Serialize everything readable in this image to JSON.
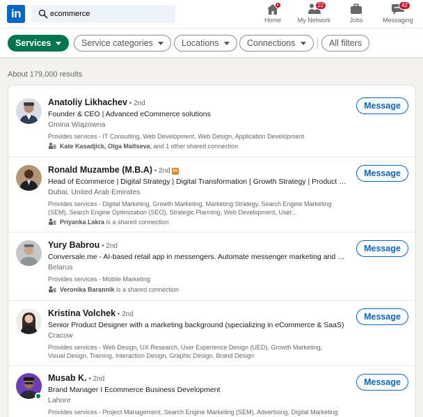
{
  "nav": {
    "logo": "in",
    "search_value": "ecommerce",
    "items": [
      {
        "label": "Home",
        "icon": "home-icon",
        "badge": ""
      },
      {
        "label": "My Network",
        "icon": "network-icon",
        "badge": "22"
      },
      {
        "label": "Jobs",
        "icon": "briefcase-icon",
        "badge": ""
      },
      {
        "label": "Messaging",
        "icon": "messaging-icon",
        "badge": "42"
      }
    ]
  },
  "filters": {
    "services": "Services",
    "service_categories": "Service categories",
    "locations": "Locations",
    "connections": "Connections",
    "all_filters": "All filters"
  },
  "results_count": "About 179,000 results",
  "colors": {
    "brand": "#0a66c2",
    "active_filter": "#01754f",
    "badge": "#cb112d"
  },
  "results": [
    {
      "name": "Anatoliy Likhachev",
      "degree": " • 2nd",
      "headline": "Founder & CEO | Advanced eCommerce solutions",
      "location": "Gmina Wiązowna",
      "services": "Provides services - IT Consulting, Web Development, Web Design, Application Development",
      "shared_names": "Kate Kasadjick, Olga Maltseva",
      "shared_rest": ", and 1 other shared connection",
      "button": "Message"
    },
    {
      "name": "Ronald Muzambe (M.B.A)",
      "degree": " • 2nd",
      "linkedin_badge": "in",
      "headline": "Head of Ecommerce | Digital Strategy | Digital Transformation | Growth Strategy | Product Management",
      "location": "Dubai, United Arab Emirates",
      "services": "Provides services - Digital Marketing, Growth Marketing, Marketing Strategy, Search Engine Marketing (SEM), Search Engine Optimization (SEO), Strategic Planning, Web Development, User...",
      "shared_names": "Priyanka Lakra",
      "shared_rest": " is a shared connection",
      "button": "Message"
    },
    {
      "name": "Yury Babrou",
      "degree": " • 2nd",
      "headline": "Conversale.me - AI-based retail app in messengers. Automate messenger marketing and sales",
      "location": "Belarus",
      "services": "Provides services - Mobile Marketing",
      "shared_names": "Veronika Barannik",
      "shared_rest": " is a shared connection",
      "button": "Message"
    },
    {
      "name": "Kristina Volchek",
      "degree": " • 2nd",
      "headline": "Senior Product Designer with a marketing background (specializing in eCommerce & SaaS)",
      "location": "Cracow",
      "services": "Provides services - Web Design, UX Research, User Experience Design (UED), Growth Marketing, Visual Design, Training, Interaction Design, Graphic Design, Brand Design",
      "button": "Message"
    },
    {
      "name": "Musab K.",
      "degree": " • 2nd",
      "headline": "Brand Manager I Ecommerce Business Development",
      "location": "Lahore",
      "services": "Provides services - Project Management, Search Engine Marketing (SEM), Advertising, Digital Marketing",
      "button": "Message"
    }
  ]
}
